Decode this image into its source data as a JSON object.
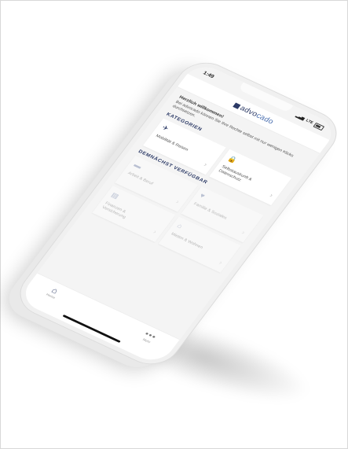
{
  "status": {
    "time": "1:49",
    "network": "LTE"
  },
  "brand": {
    "logo_part1": "advo",
    "logo_part2": "cado"
  },
  "greeting": {
    "title": "Herzlich willkommen!",
    "body": "Bei advocado können Sie Ihre Rechte selbst mit nur wenigen Klicks durchsetzen."
  },
  "sections": {
    "categories_title": "KATEGORIEN",
    "soon_title": "DEMNÄCHST VERFÜGBAR"
  },
  "categories": [
    {
      "label": "Mobilität & Reisen",
      "icon": "airplane-icon"
    },
    {
      "label": "Selbstauskunft & Datenschutz",
      "icon": "lock-icon"
    }
  ],
  "coming_soon": [
    {
      "label": "Arbeit & Beruf",
      "icon": "briefcase-icon"
    },
    {
      "label": "Familie & Soziales",
      "icon": "heart-icon"
    },
    {
      "label": "Finanzen & Versicherung",
      "icon": "document-icon"
    },
    {
      "label": "Mieten & Wohnen",
      "icon": "house-icon"
    }
  ],
  "tabbar": {
    "home_label": "Home",
    "more_label": "Mehr"
  },
  "colors": {
    "primary": "#2c3a66",
    "accent": "#4a6fb0",
    "disabled": "#b7b7b7"
  }
}
